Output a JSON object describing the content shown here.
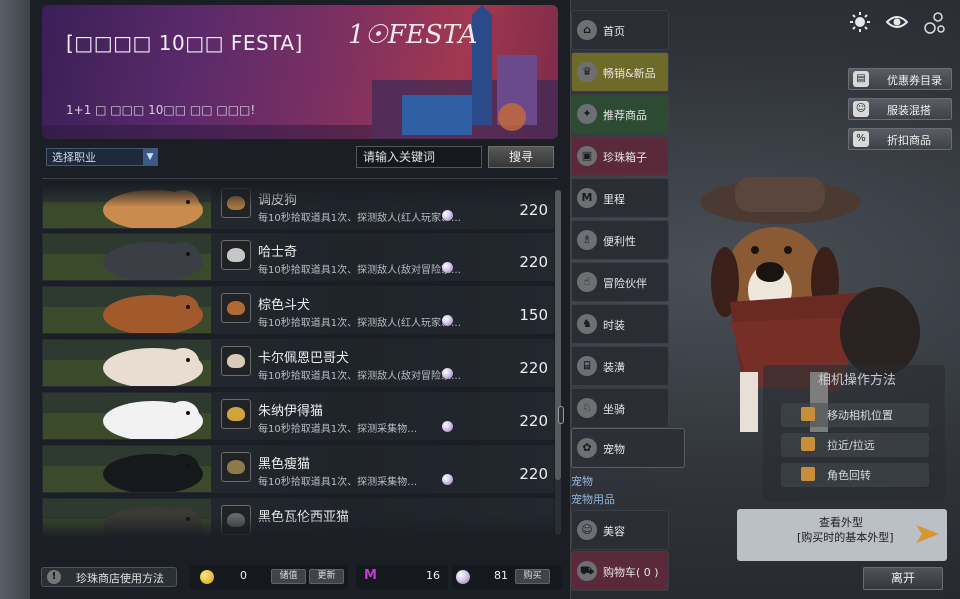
{
  "banner": {
    "title": "[□□□□ 10□□ FESTA]",
    "subtitle": "1+1 □ □□□ 10□□ □□ □□□!",
    "logo": "1☉FESTA"
  },
  "filter": {
    "job_select": "选择职业",
    "search_placeholder": "请输入关键词",
    "search_button": "搜寻"
  },
  "items": [
    {
      "name": "调皮狗",
      "desc": "每10秒拾取道具1次、探测敌人(红人玩家、…",
      "price": "220",
      "fur": "#c98b4e",
      "ico": "#a8753e"
    },
    {
      "name": "哈士奇",
      "desc": "每10秒拾取道具1次、探测敌人(敌对冒险家…",
      "price": "220",
      "fur": "#3b3e44",
      "ico": "#c7c7c7"
    },
    {
      "name": "棕色斗犬",
      "desc": "每10秒拾取道具1次、探测敌人(红人玩家、…",
      "price": "150",
      "fur": "#a25a2c",
      "ico": "#b06a32"
    },
    {
      "name": "卡尔佩恩巴哥犬",
      "desc": "每10秒拾取道具1次、探测敌人(敌对冒险家…",
      "price": "220",
      "fur": "#e8ddd0",
      "ico": "#d8cbb8"
    },
    {
      "name": "朱纳伊得猫",
      "desc": "每10秒拾取道具1次、探测采集物…",
      "price": "220",
      "fur": "#f2f2f2",
      "ico": "#d0a43a"
    },
    {
      "name": "黑色瘦猫",
      "desc": "每10秒拾取道具1次、探测采集物…",
      "price": "220",
      "fur": "#16181c",
      "ico": "#8c7a4a"
    },
    {
      "name": "黑色瓦伦西亚猫",
      "desc": "",
      "price": "",
      "fur": "#3c3a36",
      "ico": "#6a6a6a"
    }
  ],
  "footer": {
    "help": "珍珠商店使用方法",
    "silver": "0",
    "recharge": "储值",
    "refresh": "更新",
    "mileage": "16",
    "pearls": "81",
    "buy": "购买"
  },
  "nav": [
    {
      "label": "首页",
      "icon": "home-icon",
      "glyph": "⌂",
      "bg": "#2a2e34"
    },
    {
      "label": "畅销&新品",
      "icon": "trophy-icon",
      "glyph": "♛",
      "bg": "#6e6a2a"
    },
    {
      "label": "推荐商品",
      "icon": "gift-icon",
      "glyph": "✦",
      "bg": "#2d4a32"
    },
    {
      "label": "珍珠箱子",
      "icon": "chest-icon",
      "glyph": "▣",
      "bg": "#5a2a3a"
    },
    {
      "label": "里程",
      "icon": "mileage-icon",
      "glyph": "M",
      "bg": "#2a2e34"
    },
    {
      "label": "便利性",
      "icon": "flask-icon",
      "glyph": "♗",
      "bg": "#2a2e34"
    },
    {
      "label": "冒险伙伴",
      "icon": "thumbsup-icon",
      "glyph": "☝",
      "bg": "#2a2e34"
    },
    {
      "label": "时装",
      "icon": "outfit-icon",
      "glyph": "♞",
      "bg": "#2a2e34"
    },
    {
      "label": "装潢",
      "icon": "furniture-icon",
      "glyph": "⌸",
      "bg": "#2a2e34"
    },
    {
      "label": "坐骑",
      "icon": "horse-icon",
      "glyph": "♘",
      "bg": "#2a2e34"
    },
    {
      "label": "宠物",
      "icon": "paw-icon",
      "glyph": "✿",
      "bg": "#2c3036"
    },
    {
      "label": "美容",
      "icon": "beauty-icon",
      "glyph": "☺",
      "bg": "#2a2e34"
    },
    {
      "label": "购物车( 0 )",
      "icon": "cart-icon",
      "glyph": "⛟",
      "bg": "#5a2a3a"
    }
  ],
  "nav_sub": [
    "宠物",
    "宠物用品"
  ],
  "right_buttons": [
    "优惠券目录",
    "服装混搭",
    "折扣商品"
  ],
  "camera": {
    "title": "相机操作方法",
    "rows": [
      "移动相机位置",
      "拉近/拉远",
      "角色回转"
    ]
  },
  "view": {
    "line1": "查看外型",
    "line2": "[购买时的基本外型]"
  },
  "exit": "离开"
}
